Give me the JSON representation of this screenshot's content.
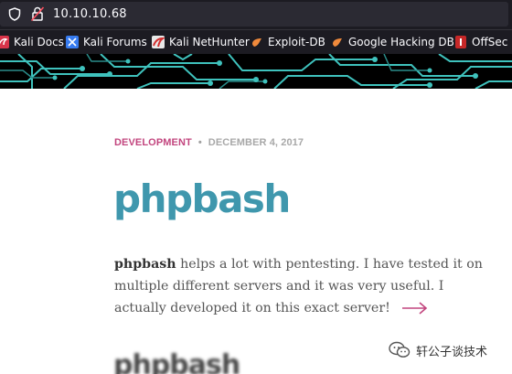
{
  "browser": {
    "url": "10.10.10.68",
    "bookmarks": [
      {
        "label": "Kali Docs",
        "icon": "kali-dragon-icon"
      },
      {
        "label": "Kali Forums",
        "icon": "kali-forums-icon"
      },
      {
        "label": "Kali NetHunter",
        "icon": "nethunter-icon"
      },
      {
        "label": "Exploit-DB",
        "icon": "exploit-db-icon"
      },
      {
        "label": "Google Hacking DB",
        "icon": "exploit-db-icon"
      },
      {
        "label": "OffSec",
        "icon": "offsec-icon"
      }
    ]
  },
  "post": {
    "category": "DEVELOPMENT",
    "separator": "•",
    "date": "DECEMBER 4, 2017",
    "title": "phpbash",
    "excerpt_bold": "phpbash",
    "excerpt_rest": " helps a lot with pentesting. I have tested it on multiple different servers and it was very useful. I actually developed it on this exact server!",
    "next_title": "phpbash"
  },
  "watermark": {
    "text": "轩公子谈技术"
  },
  "colors": {
    "accent_pink": "#c2457e",
    "title_teal": "#3f97ad",
    "circuit": "#3fc2bd"
  }
}
